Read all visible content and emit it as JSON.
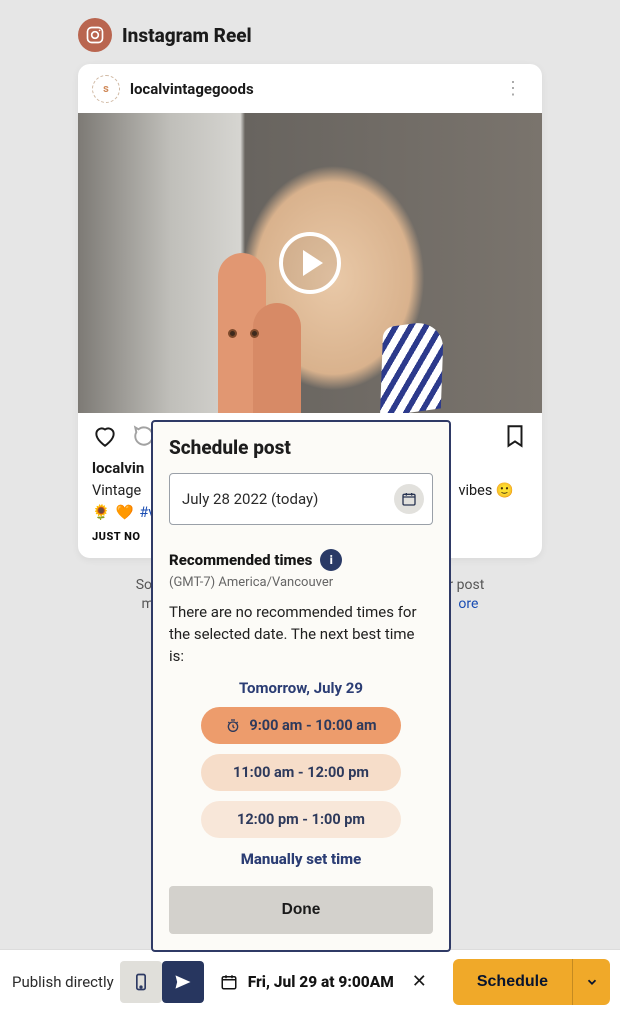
{
  "header": {
    "title": "Instagram Reel"
  },
  "post": {
    "username": "localvintagegoods",
    "avatar_letter": "s",
    "caption_user": "localvin",
    "caption_text": "Vintage",
    "caption_tail": "vibes 🙂",
    "hashtag_fragment": "#vi",
    "time_label": "JUST NO"
  },
  "footer_note": {
    "line1_a": "Social",
    "line1_b": "ur post",
    "line2_a": "ma",
    "more": "ore"
  },
  "popover": {
    "title": "Schedule post",
    "date_value": "July 28 2022 (today)",
    "rec_label": "Recommended times",
    "timezone": "(GMT-7) America/Vancouver",
    "message": "There are no recommended times for the selected date. The next best time is:",
    "next_date": "Tomorrow, July 29",
    "slots": [
      "9:00 am - 10:00 am",
      "11:00 am - 12:00 pm",
      "12:00 pm - 1:00 pm"
    ],
    "manual": "Manually set time",
    "done": "Done"
  },
  "bottombar": {
    "publish_label": "Publish directly",
    "scheduled_display": "Fri, Jul 29 at 9:00AM",
    "schedule_btn": "Schedule"
  }
}
